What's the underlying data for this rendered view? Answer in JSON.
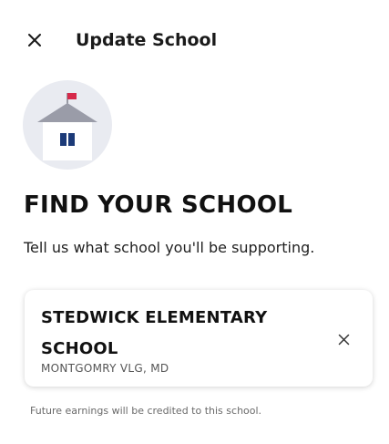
{
  "header": {
    "title": "Update School",
    "close_icon": "close-icon"
  },
  "illustration": {
    "icon": "school-house-icon",
    "colors": {
      "circle": "#e9ebf1",
      "roof": "#9a9ca8",
      "wall": "#ffffff",
      "door": "#1c3a78",
      "flag": "#d6294a"
    }
  },
  "main": {
    "heading": "FIND YOUR SCHOOL",
    "subtext": "Tell us what school you'll be supporting."
  },
  "selected_school": {
    "name": "STEDWICK ELEMENTARY SCHOOL",
    "location": "MONTGOMRY VLG, MD",
    "clear_icon": "close-icon"
  },
  "footnote": "Future earnings will be credited to this school."
}
